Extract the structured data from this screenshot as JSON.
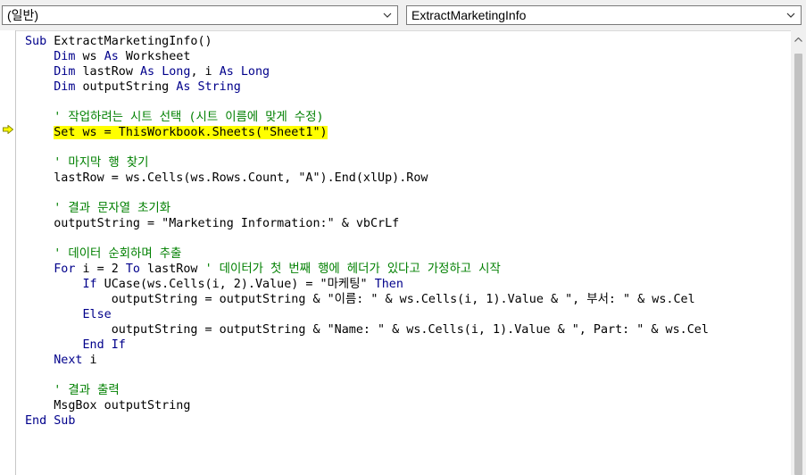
{
  "toolbar": {
    "object_combo": "(일반)",
    "procedure_combo": "ExtractMarketingInfo"
  },
  "icons": {
    "dropdown": "chevron-down-icon",
    "execution_pointer": "execution-arrow-icon",
    "scroll_up": "scroll-up-icon"
  },
  "colors": {
    "keyword": "#00008b",
    "comment": "#008000",
    "current_line_highlight": "#ffff00"
  },
  "code": {
    "lines": [
      [
        {
          "t": "Sub",
          "c": "kw"
        },
        {
          "t": " ExtractMarketingInfo()"
        }
      ],
      [
        {
          "t": "    "
        },
        {
          "t": "Dim",
          "c": "kw"
        },
        {
          "t": " ws "
        },
        {
          "t": "As",
          "c": "kw"
        },
        {
          "t": " Worksheet"
        }
      ],
      [
        {
          "t": "    "
        },
        {
          "t": "Dim",
          "c": "kw"
        },
        {
          "t": " lastRow "
        },
        {
          "t": "As",
          "c": "kw"
        },
        {
          "t": " "
        },
        {
          "t": "Long",
          "c": "kw"
        },
        {
          "t": ", i "
        },
        {
          "t": "As",
          "c": "kw"
        },
        {
          "t": " "
        },
        {
          "t": "Long",
          "c": "kw"
        }
      ],
      [
        {
          "t": "    "
        },
        {
          "t": "Dim",
          "c": "kw"
        },
        {
          "t": " outputString "
        },
        {
          "t": "As",
          "c": "kw"
        },
        {
          "t": " "
        },
        {
          "t": "String",
          "c": "kw"
        }
      ],
      [],
      [
        {
          "t": "    "
        },
        {
          "t": "' 작업하려는 시트 선택 (시트 이름에 맞게 수정)",
          "c": "cm"
        }
      ],
      [
        {
          "t": "    "
        },
        {
          "t": "Set ws = ThisWorkbook.Sheets(\"Sheet1\")",
          "c": "hl"
        }
      ],
      [],
      [
        {
          "t": "    "
        },
        {
          "t": "' 마지막 행 찾기",
          "c": "cm"
        }
      ],
      [
        {
          "t": "    lastRow = ws.Cells(ws.Rows.Count, \"A\").End(xlUp).Row"
        }
      ],
      [],
      [
        {
          "t": "    "
        },
        {
          "t": "' 결과 문자열 초기화",
          "c": "cm"
        }
      ],
      [
        {
          "t": "    outputString = \"Marketing Information:\" & vbCrLf"
        }
      ],
      [],
      [
        {
          "t": "    "
        },
        {
          "t": "' 데이터 순회하며 추출",
          "c": "cm"
        }
      ],
      [
        {
          "t": "    "
        },
        {
          "t": "For",
          "c": "kw"
        },
        {
          "t": " i = 2 "
        },
        {
          "t": "To",
          "c": "kw"
        },
        {
          "t": " lastRow "
        },
        {
          "t": "' 데이터가 첫 번째 행에 헤더가 있다고 가정하고 시작",
          "c": "cm"
        }
      ],
      [
        {
          "t": "        "
        },
        {
          "t": "If",
          "c": "kw"
        },
        {
          "t": " UCase(ws.Cells(i, 2).Value) = \"마케팅\" "
        },
        {
          "t": "Then",
          "c": "kw"
        }
      ],
      [
        {
          "t": "            outputString = outputString & \"이름: \" & ws.Cells(i, 1).Value & \", 부서: \" & ws.Cel"
        }
      ],
      [
        {
          "t": "        "
        },
        {
          "t": "Else",
          "c": "kw"
        }
      ],
      [
        {
          "t": "            outputString = outputString & \"Name: \" & ws.Cells(i, 1).Value & \", Part: \" & ws.Cel"
        }
      ],
      [
        {
          "t": "        "
        },
        {
          "t": "End If",
          "c": "kw"
        }
      ],
      [
        {
          "t": "    "
        },
        {
          "t": "Next",
          "c": "kw"
        },
        {
          "t": " i"
        }
      ],
      [],
      [
        {
          "t": "    "
        },
        {
          "t": "' 결과 출력",
          "c": "cm"
        }
      ],
      [
        {
          "t": "    MsgBox outputString"
        }
      ],
      [
        {
          "t": "End Sub",
          "c": "kw"
        }
      ]
    ]
  }
}
